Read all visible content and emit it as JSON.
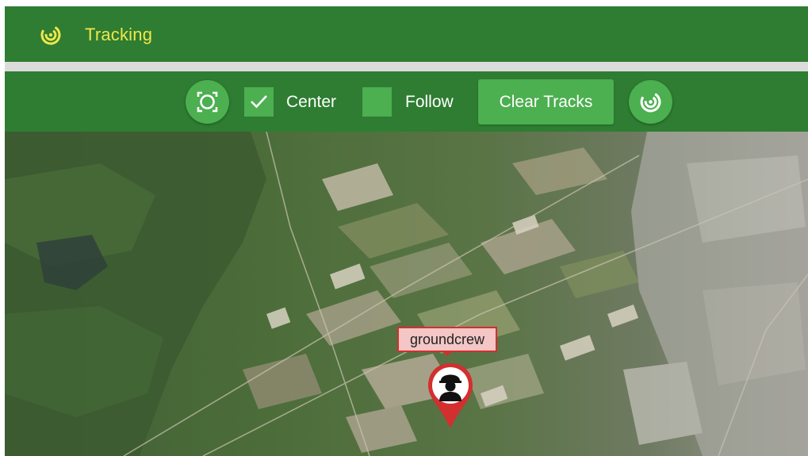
{
  "header": {
    "title": "Tracking",
    "logo_icon": "radar-icon"
  },
  "toolbar": {
    "fit_button_icon": "fit-bounds-icon",
    "center": {
      "label": "Center",
      "checked": true
    },
    "follow": {
      "label": "Follow",
      "checked": false
    },
    "clear_tracks_label": "Clear Tracks",
    "tracking_button_icon": "radar-icon"
  },
  "map": {
    "marker": {
      "label": "groundcrew",
      "icon": "worker-helmet-icon"
    }
  },
  "colors": {
    "primary": "#2e7d32",
    "button": "#4caf50",
    "title": "#f0e64a",
    "marker": "#d32f2f"
  }
}
